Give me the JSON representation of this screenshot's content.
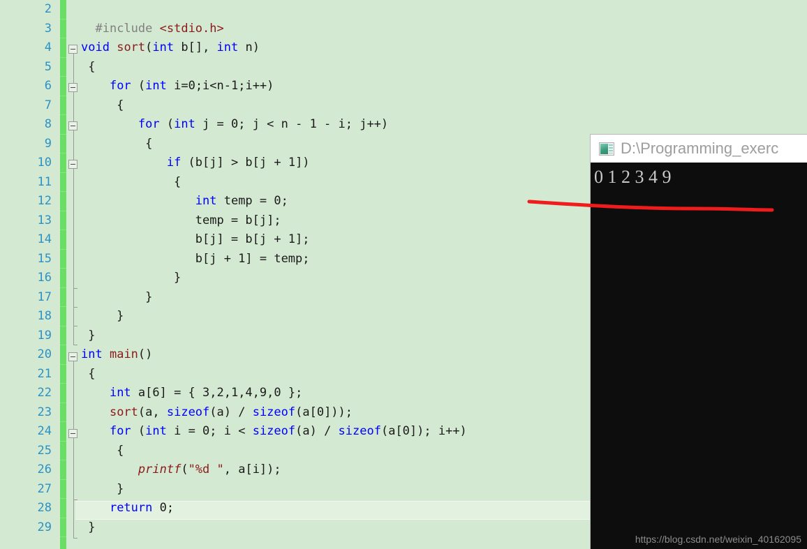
{
  "editor": {
    "background_color": "#d4e9d2",
    "line_number_color": "#2b91c4",
    "change_bar_color": "#69de64",
    "first_line_number": 2,
    "lines": [
      {
        "n": 2,
        "indent": 0,
        "fold": null,
        "tokens": []
      },
      {
        "n": 3,
        "indent": 0,
        "fold": null,
        "tokens": [
          {
            "t": "  ",
            "c": "pl"
          },
          {
            "t": "#include",
            "c": "pp"
          },
          {
            "t": " ",
            "c": "pl"
          },
          {
            "t": "<stdio.h>",
            "c": "str"
          }
        ]
      },
      {
        "n": 4,
        "indent": 0,
        "fold": "open",
        "tokens": [
          {
            "t": "void",
            "c": "kw"
          },
          {
            "t": " ",
            "c": "pl"
          },
          {
            "t": "sort",
            "c": "fn"
          },
          {
            "t": "(",
            "c": "pl"
          },
          {
            "t": "int",
            "c": "kw"
          },
          {
            "t": " b[], ",
            "c": "pl"
          },
          {
            "t": "int",
            "c": "kw"
          },
          {
            "t": " n)",
            "c": "pl"
          }
        ]
      },
      {
        "n": 5,
        "indent": 0,
        "fold": null,
        "tokens": [
          {
            "t": " {",
            "c": "pl"
          }
        ]
      },
      {
        "n": 6,
        "indent": 0,
        "fold": "open",
        "tokens": [
          {
            "t": "    ",
            "c": "pl"
          },
          {
            "t": "for",
            "c": "kw"
          },
          {
            "t": " (",
            "c": "pl"
          },
          {
            "t": "int",
            "c": "kw"
          },
          {
            "t": " i=0;i<n-1;i++)",
            "c": "pl"
          }
        ]
      },
      {
        "n": 7,
        "indent": 0,
        "fold": null,
        "tokens": [
          {
            "t": "     {",
            "c": "pl"
          }
        ]
      },
      {
        "n": 8,
        "indent": 0,
        "fold": "open",
        "tokens": [
          {
            "t": "        ",
            "c": "pl"
          },
          {
            "t": "for",
            "c": "kw"
          },
          {
            "t": " (",
            "c": "pl"
          },
          {
            "t": "int",
            "c": "kw"
          },
          {
            "t": " j = 0; j < n - 1 - i; j++)",
            "c": "pl"
          }
        ]
      },
      {
        "n": 9,
        "indent": 0,
        "fold": null,
        "tokens": [
          {
            "t": "         {",
            "c": "pl"
          }
        ]
      },
      {
        "n": 10,
        "indent": 0,
        "fold": "open",
        "tokens": [
          {
            "t": "            ",
            "c": "pl"
          },
          {
            "t": "if",
            "c": "kw"
          },
          {
            "t": " (b[j] > b[j + 1])",
            "c": "pl"
          }
        ]
      },
      {
        "n": 11,
        "indent": 0,
        "fold": null,
        "tokens": [
          {
            "t": "             {",
            "c": "pl"
          }
        ]
      },
      {
        "n": 12,
        "indent": 0,
        "fold": null,
        "tokens": [
          {
            "t": "                ",
            "c": "pl"
          },
          {
            "t": "int",
            "c": "kw"
          },
          {
            "t": " temp = 0;",
            "c": "pl"
          }
        ]
      },
      {
        "n": 13,
        "indent": 0,
        "fold": null,
        "tokens": [
          {
            "t": "                temp = b[j];",
            "c": "pl"
          }
        ]
      },
      {
        "n": 14,
        "indent": 0,
        "fold": null,
        "tokens": [
          {
            "t": "                b[j] = b[j + 1];",
            "c": "pl"
          }
        ]
      },
      {
        "n": 15,
        "indent": 0,
        "fold": null,
        "tokens": [
          {
            "t": "                b[j + 1] = temp;",
            "c": "pl"
          }
        ]
      },
      {
        "n": 16,
        "indent": 0,
        "fold": null,
        "tokens": [
          {
            "t": "             }",
            "c": "pl"
          }
        ]
      },
      {
        "n": 17,
        "indent": 0,
        "fold": null,
        "tokens": [
          {
            "t": "         }",
            "c": "pl"
          }
        ]
      },
      {
        "n": 18,
        "indent": 0,
        "fold": null,
        "tokens": [
          {
            "t": "     }",
            "c": "pl"
          }
        ]
      },
      {
        "n": 19,
        "indent": 0,
        "fold": null,
        "tokens": [
          {
            "t": " }",
            "c": "pl"
          }
        ]
      },
      {
        "n": 20,
        "indent": 0,
        "fold": "open",
        "tokens": [
          {
            "t": "int",
            "c": "kw"
          },
          {
            "t": " ",
            "c": "pl"
          },
          {
            "t": "main",
            "c": "fn"
          },
          {
            "t": "()",
            "c": "pl"
          }
        ]
      },
      {
        "n": 21,
        "indent": 0,
        "fold": null,
        "tokens": [
          {
            "t": " {",
            "c": "pl"
          }
        ]
      },
      {
        "n": 22,
        "indent": 0,
        "fold": null,
        "tokens": [
          {
            "t": "    ",
            "c": "pl"
          },
          {
            "t": "int",
            "c": "kw"
          },
          {
            "t": " a[6] = { 3,2,1,4,9,0 };",
            "c": "pl"
          }
        ]
      },
      {
        "n": 23,
        "indent": 0,
        "fold": null,
        "tokens": [
          {
            "t": "    ",
            "c": "pl"
          },
          {
            "t": "sort",
            "c": "fn"
          },
          {
            "t": "(a, ",
            "c": "pl"
          },
          {
            "t": "sizeof",
            "c": "kw"
          },
          {
            "t": "(a) / ",
            "c": "pl"
          },
          {
            "t": "sizeof",
            "c": "kw"
          },
          {
            "t": "(a[0]));",
            "c": "pl"
          }
        ]
      },
      {
        "n": 24,
        "indent": 0,
        "fold": "open",
        "tokens": [
          {
            "t": "    ",
            "c": "pl"
          },
          {
            "t": "for",
            "c": "kw"
          },
          {
            "t": " (",
            "c": "pl"
          },
          {
            "t": "int",
            "c": "kw"
          },
          {
            "t": " i = 0; i < ",
            "c": "pl"
          },
          {
            "t": "sizeof",
            "c": "kw"
          },
          {
            "t": "(a) / ",
            "c": "pl"
          },
          {
            "t": "sizeof",
            "c": "kw"
          },
          {
            "t": "(a[0]); i++)",
            "c": "pl"
          }
        ]
      },
      {
        "n": 25,
        "indent": 0,
        "fold": null,
        "tokens": [
          {
            "t": "     {",
            "c": "pl"
          }
        ]
      },
      {
        "n": 26,
        "indent": 0,
        "fold": null,
        "tokens": [
          {
            "t": "        ",
            "c": "pl"
          },
          {
            "t": "printf",
            "c": "fni"
          },
          {
            "t": "(",
            "c": "pl"
          },
          {
            "t": "\"%d \"",
            "c": "str"
          },
          {
            "t": ", a[i]);",
            "c": "pl"
          }
        ]
      },
      {
        "n": 27,
        "indent": 0,
        "fold": null,
        "tokens": [
          {
            "t": "     }",
            "c": "pl"
          }
        ]
      },
      {
        "n": 28,
        "indent": 0,
        "fold": null,
        "tokens": [
          {
            "t": "    ",
            "c": "pl"
          },
          {
            "t": "return",
            "c": "kw"
          },
          {
            "t": " 0;",
            "c": "pl"
          }
        ]
      },
      {
        "n": 29,
        "indent": 0,
        "fold": null,
        "tokens": [
          {
            "t": " }",
            "c": "pl"
          }
        ]
      }
    ],
    "current_line": 28,
    "source_text": "#include <stdio.h>\nvoid sort(int b[], int n)\n{\n    for (int i=0;i<n-1;i++)\n    {\n        for (int j = 0; j < n - 1 - i; j++)\n        {\n            if (b[j] > b[j + 1])\n            {\n                int temp = 0;\n                temp = b[j];\n                b[j] = b[j + 1];\n                b[j + 1] = temp;\n            }\n        }\n    }\n}\nint main()\n{\n    int a[6] = { 3,2,1,4,9,0 };\n    sort(a, sizeof(a) / sizeof(a[0]));\n    for (int i = 0; i < sizeof(a) / sizeof(a[0]); i++)\n    {\n        printf(\"%d \", a[i]);\n    }\n    return 0;\n}"
  },
  "console": {
    "title": "D:\\Programming_exerc",
    "icon": "console-window-icon",
    "output": "0 1 2 3 4 9",
    "background_color": "#0d0d0d",
    "text_color": "#c9c9c9",
    "watermark": "https://blog.csdn.net/weixin_40162095"
  },
  "annotation": {
    "type": "red-underline",
    "color": "#ee1c1c",
    "description": "hand-drawn red line under console output"
  }
}
